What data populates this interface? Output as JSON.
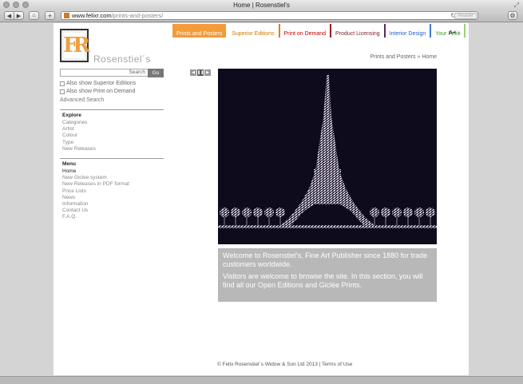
{
  "window": {
    "title": "Home | Rosenstiel's"
  },
  "browser": {
    "url_host": "www.felixr.com",
    "url_path": "/prints-and-posters/",
    "reader_label": "Reader"
  },
  "brand": {
    "name": "Rosenstiel´s",
    "logo_letters": "FR"
  },
  "nav": {
    "items": [
      {
        "label": "Prints and Posters"
      },
      {
        "label": "Superior Editions"
      },
      {
        "label": "Print on Demand"
      },
      {
        "label": "Product Licensing"
      },
      {
        "label": "Interior Design"
      },
      {
        "label": "Your Felix"
      }
    ],
    "font_large": "A+",
    "font_small": "A-"
  },
  "breadcrumb": "Prints and Posters » Home",
  "search": {
    "placeholder": "Search",
    "go_label": "Go"
  },
  "options": {
    "superior": "Also show Superior Editions",
    "pod": "Also show Print on Demand",
    "advanced": "Advanced Search"
  },
  "explore": {
    "title": "Explore",
    "items": [
      "Categories",
      "Artist",
      "Colour",
      "Type",
      "New Releases"
    ]
  },
  "menu": {
    "title": "Menu",
    "items": [
      "Home",
      "New Giclee system",
      "New Releases in PDF format",
      "Price Lists",
      "News",
      "Information",
      "Contact Us",
      "F.A.Q."
    ]
  },
  "welcome": {
    "line1": "Welcome to Rosenstiel's, Fine Art Publisher since 1880 for trade customers worldwide.",
    "line2": "Visitors are welcome to browse the site. In this section, you will find all our Open Editions and Giclée Prints."
  },
  "footer": {
    "copyright": "© Felix Rosenstiel´s Widow & Son Ltd 2013 |",
    "terms": "Terms of Use"
  }
}
